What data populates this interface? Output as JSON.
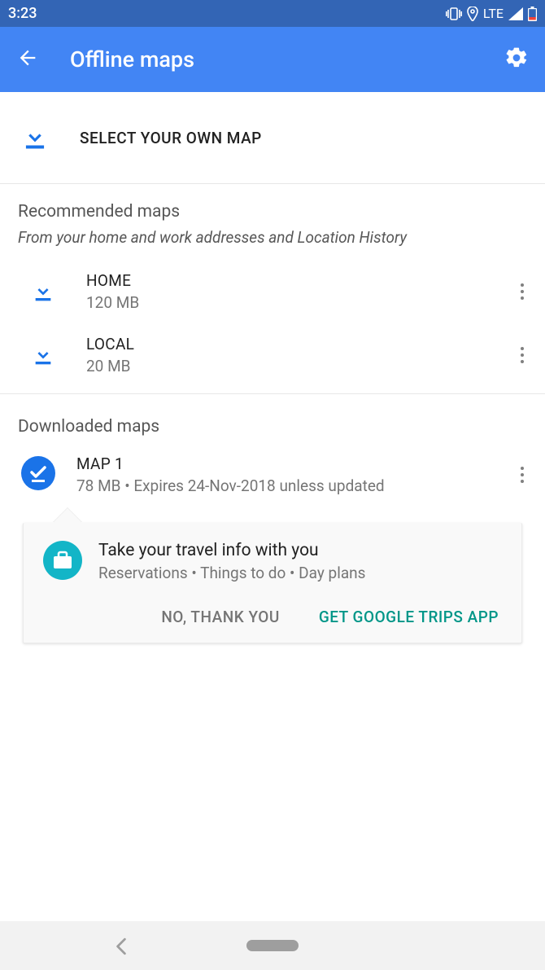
{
  "status": {
    "time": "3:23",
    "network": "LTE"
  },
  "appbar": {
    "title": "Offline maps"
  },
  "select_own": {
    "label": "SELECT YOUR OWN MAP"
  },
  "recommended": {
    "title": "Recommended maps",
    "subtitle": "From your home and work addresses and Location History",
    "items": [
      {
        "name": "HOME",
        "size": "120 MB"
      },
      {
        "name": "LOCAL",
        "size": "20 MB"
      }
    ]
  },
  "downloaded": {
    "title": "Downloaded maps",
    "items": [
      {
        "name": "MAP 1",
        "detail": "78 MB • Expires 24-Nov-2018 unless updated"
      }
    ]
  },
  "promo": {
    "title": "Take your travel info with you",
    "subtitle": "Reservations • Things to do • Day plans",
    "decline": "NO, THANK YOU",
    "accept": "GET GOOGLE TRIPS APP"
  }
}
